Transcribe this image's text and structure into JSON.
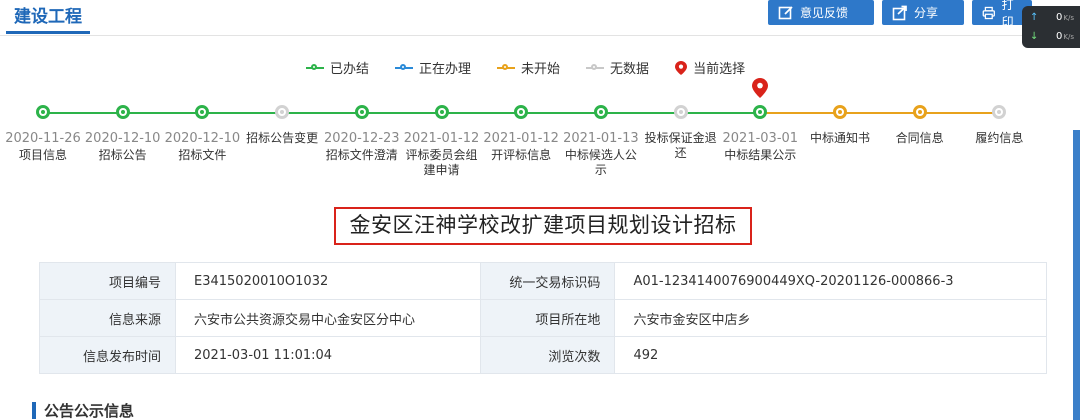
{
  "section_tab": "建设工程",
  "actions": {
    "feedback": "意见反馈",
    "share": "分享",
    "print": "打印"
  },
  "netmon": {
    "up_value": "0",
    "up_unit": "K/s",
    "down_value": "0",
    "down_unit": "K/s"
  },
  "legend": {
    "done": "已办结",
    "doing": "正在办理",
    "not_started": "未开始",
    "no_data": "无数据",
    "current": "当前选择"
  },
  "colors": {
    "done": "#2db34a",
    "doing": "#2a8ad8",
    "not_started": "#e8a21c",
    "no_data": "#c8c8c8",
    "current_pin": "#d9231a",
    "accent": "#1f68b8"
  },
  "timeline": [
    {
      "date": "2020-11-26",
      "label": "项目信息",
      "status": "done"
    },
    {
      "date": "2020-12-10",
      "label": "招标公告",
      "status": "done"
    },
    {
      "date": "2020-12-10",
      "label": "招标文件",
      "status": "done"
    },
    {
      "date": "",
      "label": "招标公告变更",
      "status": "none"
    },
    {
      "date": "2020-12-23",
      "label": "招标文件澄清",
      "status": "done"
    },
    {
      "date": "2021-01-12",
      "label": "评标委员会组建申请",
      "status": "done"
    },
    {
      "date": "2021-01-12",
      "label": "开评标信息",
      "status": "done"
    },
    {
      "date": "2021-01-13",
      "label": "中标候选人公示",
      "status": "done"
    },
    {
      "date": "",
      "label": "投标保证金退还",
      "status": "none"
    },
    {
      "date": "2021-03-01",
      "label": "中标结果公示",
      "status": "done",
      "current": true
    },
    {
      "date": "",
      "label": "中标通知书",
      "status": "notyet"
    },
    {
      "date": "",
      "label": "合同信息",
      "status": "notyet"
    },
    {
      "date": "",
      "label": "履约信息",
      "status": "none"
    }
  ],
  "project_title": "金安区汪神学校改扩建项目规划设计招标",
  "info": {
    "code_label": "项目编号",
    "code_value": "E3415020010O1032",
    "trade_id_label": "统一交易标识码",
    "trade_id_value": "A01-1234140076900449XQ-20201126-000866-3",
    "source_label": "信息来源",
    "source_value": "六安市公共资源交易中心金安区分中心",
    "location_label": "项目所在地",
    "location_value": "六安市金安区中店乡",
    "publish_label": "信息发布时间",
    "publish_value": "2021-03-01 11:01:04",
    "views_label": "浏览次数",
    "views_value": "492"
  },
  "announcement_heading": "公告公示信息"
}
